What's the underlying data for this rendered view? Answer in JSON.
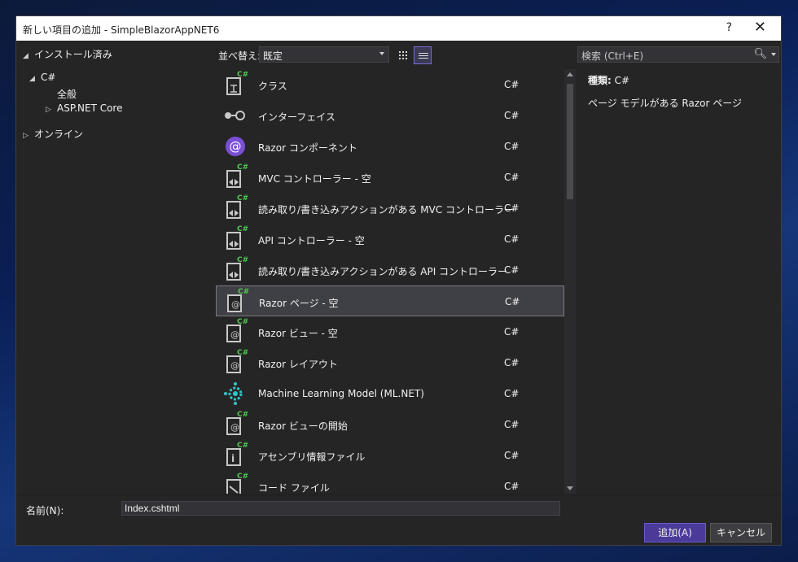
{
  "window": {
    "title": "新しい項目の追加 - SimpleBlazorAppNET6",
    "help": "?",
    "close": "✕"
  },
  "tree": {
    "installed": "インストール済み",
    "csharp": "C#",
    "general": "全般",
    "aspnet": "ASP.NET Core",
    "online": "オンライン"
  },
  "toolbar": {
    "sort_label": "並べ替え:",
    "sort_value": "既定"
  },
  "search": {
    "placeholder": "検索 (Ctrl+E)"
  },
  "items": [
    {
      "name": "クラス",
      "lang": "C#",
      "icon": "class-icon"
    },
    {
      "name": "インターフェイス",
      "lang": "C#",
      "icon": "interface-icon"
    },
    {
      "name": "Razor コンポーネント",
      "lang": "C#",
      "icon": "blazor-icon"
    },
    {
      "name": "MVC コントローラー - 空",
      "lang": "C#",
      "icon": "controller-icon"
    },
    {
      "name": "読み取り/書き込みアクションがある MVC コントローラー",
      "lang": "C#",
      "icon": "controller-icon"
    },
    {
      "name": "API コントローラー - 空",
      "lang": "C#",
      "icon": "controller-icon"
    },
    {
      "name": "読み取り/書き込みアクションがある API コントローラー",
      "lang": "C#",
      "icon": "controller-icon"
    },
    {
      "name": "Razor ページ - 空",
      "lang": "C#",
      "icon": "razor-page-icon"
    },
    {
      "name": "Razor ビュー - 空",
      "lang": "C#",
      "icon": "razor-view-icon"
    },
    {
      "name": "Razor レイアウト",
      "lang": "C#",
      "icon": "razor-layout-icon"
    },
    {
      "name": "Machine Learning Model (ML.NET)",
      "lang": "C#",
      "icon": "ml-gear-icon"
    },
    {
      "name": "Razor ビューの開始",
      "lang": "C#",
      "icon": "razor-view-start-icon"
    },
    {
      "name": "アセンブリ情報ファイル",
      "lang": "C#",
      "icon": "assembly-info-icon"
    },
    {
      "name": "コード ファイル",
      "lang": "C#",
      "icon": "code-file-icon"
    }
  ],
  "selected_index": 7,
  "details": {
    "type_label": "種類:",
    "type_value": "C#",
    "description": "ページ モデルがある Razor ページ"
  },
  "footer": {
    "name_label": "名前(N):",
    "name_value": "Index.cshtml",
    "add_button": "追加(A)",
    "cancel_button": "キャンセル"
  },
  "colors": {
    "accent": "#4b3a9a",
    "csharp_badge": "#4ec94e",
    "blazor": "#7a4fd6",
    "ml": "#2fc4c8"
  }
}
